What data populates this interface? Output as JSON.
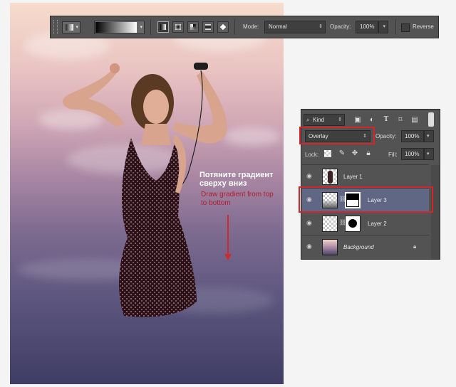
{
  "options_bar": {
    "mode_label": "Mode:",
    "mode_value": "Normal",
    "opacity_label": "Opacity:",
    "opacity_value": "100%",
    "reverse_label": "Reverse",
    "gradient_types": [
      "linear",
      "radial",
      "angle",
      "reflected",
      "diamond"
    ],
    "active_gradient_type": "linear"
  },
  "layers_panel": {
    "filter_kind": "Kind",
    "blend_mode": "Overlay",
    "opacity_label": "Opacity:",
    "opacity_value": "100%",
    "lock_label": "Lock:",
    "fill_label": "Fill:",
    "fill_value": "100%",
    "layers": [
      {
        "name": "Layer 1",
        "visible": true,
        "selected": false
      },
      {
        "name": "Layer 3",
        "visible": true,
        "selected": true,
        "has_mask": true
      },
      {
        "name": "Layer 2",
        "visible": true,
        "selected": false,
        "has_mask": true
      },
      {
        "name": "Background",
        "visible": true,
        "selected": false,
        "locked": true
      }
    ]
  },
  "annotation": {
    "russian": "Потяните градиент сверху вниз",
    "english": "Draw gradient from top to bottom"
  },
  "colors": {
    "highlight_red": "#d4252a",
    "selected_layer": "#5f6784",
    "panel_bg": "#535353"
  }
}
